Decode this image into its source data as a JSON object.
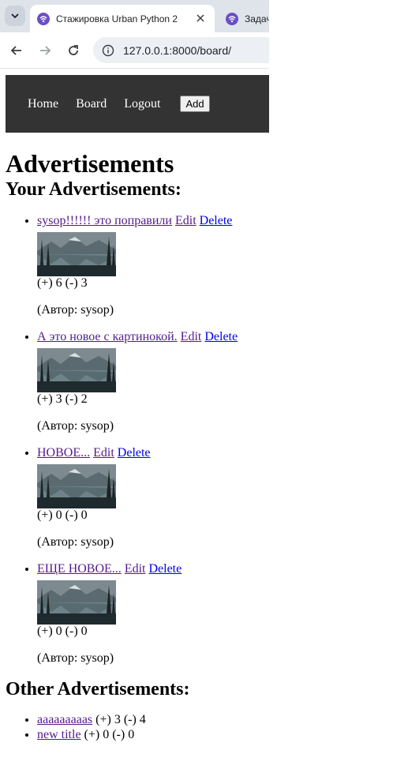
{
  "browser": {
    "active_tab_title": "Стажировка Urban Python 2",
    "inactive_tab_title": "Задач",
    "url": "127.0.0.1:8000/board/"
  },
  "nav": {
    "home": "Home",
    "board": "Board",
    "logout": "Logout",
    "add": "Add"
  },
  "page": {
    "title": "Advertisements",
    "your_heading": "Your Advertisements:",
    "other_heading": "Other Advertisements:"
  },
  "your_ads": [
    {
      "title": "sysop!!!!!! это поправили",
      "edit": "Edit",
      "delete": "Delete",
      "votes": "(+) 6 (-) 3",
      "author": "(Автор: sysop)"
    },
    {
      "title": "А это новое с картинокой.",
      "edit": "Edit",
      "delete": "Delete",
      "votes": "(+) 3 (-) 2",
      "author": "(Автор: sysop)"
    },
    {
      "title": "НОВОЕ...",
      "edit": "Edit",
      "delete": "Delete",
      "votes": "(+) 0 (-) 0",
      "author": "(Автор: sysop)"
    },
    {
      "title": "ЕЩЕ НОВОЕ...",
      "edit": "Edit",
      "delete": "Delete",
      "votes": "(+) 0 (-) 0",
      "author": "(Автор: sysop)"
    }
  ],
  "other_ads": [
    {
      "title": "aaaaaaaaas",
      "votes": "(+) 3 (-) 4"
    },
    {
      "title": "new title",
      "votes": "(+) 0 (-) 0"
    }
  ],
  "colors": {
    "navbar_bg": "#333333",
    "visited_link": "#551a8b",
    "link": "#0000ee",
    "tabstrip_bg": "#dfe3ea"
  }
}
